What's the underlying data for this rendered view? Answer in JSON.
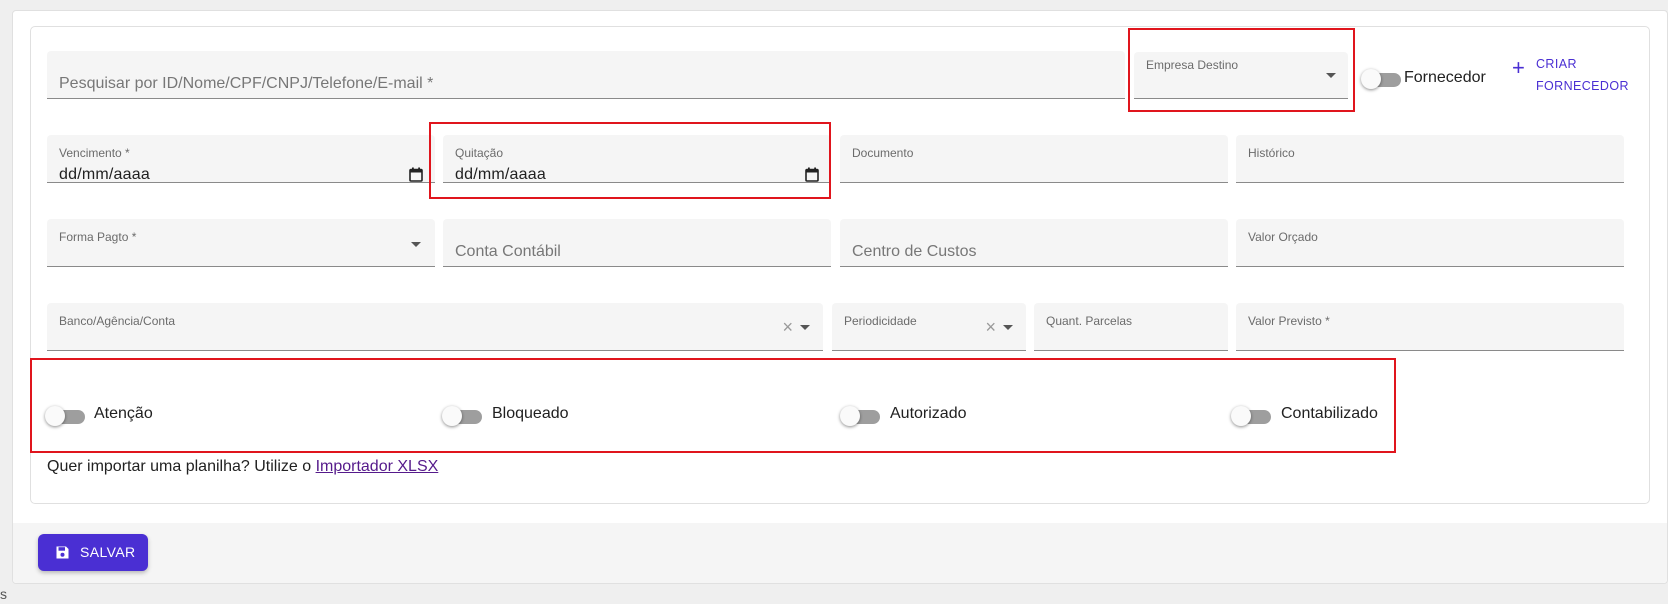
{
  "search": {
    "placeholder": "Pesquisar por ID/Nome/CPF/CNPJ/Telefone/E-mail *"
  },
  "empresa_destino": {
    "label": "Empresa Destino",
    "value": ""
  },
  "fornecedor_toggle": {
    "label": "Fornecedor",
    "checked": false
  },
  "criar_fornecedor": {
    "line1": "CRIAR",
    "line2": "FORNECEDOR"
  },
  "vencimento": {
    "label": "Vencimento *",
    "value": "dd/mm/aaaa"
  },
  "quitacao": {
    "label": "Quitação",
    "value": "dd/mm/aaaa"
  },
  "documento": {
    "label": "Documento"
  },
  "historico": {
    "label": "Histórico"
  },
  "forma_pagto": {
    "label": "Forma Pagto *"
  },
  "conta_contabil": {
    "placeholder": "Conta Contábil"
  },
  "centro_custos": {
    "placeholder": "Centro de Custos"
  },
  "valor_orcado": {
    "label": "Valor Orçado"
  },
  "banco": {
    "label": "Banco/Agência/Conta"
  },
  "periodicidade": {
    "label": "Periodicidade"
  },
  "quant_parcelas": {
    "label": "Quant. Parcelas"
  },
  "valor_previsto": {
    "label": "Valor Previsto *"
  },
  "toggles": [
    {
      "label": "Atenção",
      "checked": false
    },
    {
      "label": "Bloqueado",
      "checked": false
    },
    {
      "label": "Autorizado",
      "checked": false
    },
    {
      "label": "Contabilizado",
      "checked": false
    }
  ],
  "import": {
    "text": "Quer importar uma planilha? Utilize o ",
    "link": "Importador XLSX"
  },
  "save_button": {
    "label": "SALVAR"
  },
  "stray_text": "s",
  "colors": {
    "accent": "#4a2fd3",
    "highlight": "#e0151d",
    "field_bg": "#f5f5f5"
  }
}
